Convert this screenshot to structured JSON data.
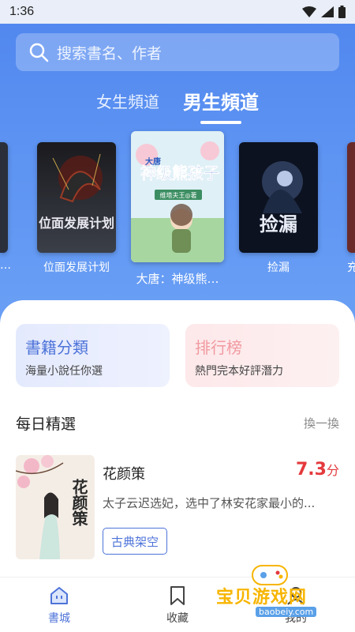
{
  "status": {
    "time": "1:36"
  },
  "search": {
    "placeholder": "搜索書名、作者"
  },
  "tabs": [
    {
      "label": "女生頻道",
      "active": false
    },
    {
      "label": "男生頻道",
      "active": true
    }
  ],
  "carousel": {
    "items": [
      {
        "title": "…"
      },
      {
        "title": "位面发展计划",
        "cover_text": "位面发展计划"
      },
      {
        "title": "大唐：神级熊…",
        "cover_text": "神级熊孩子",
        "cover_prefix": "大唐",
        "cover_author": "维塔夫王◎著"
      },
      {
        "title": "捡漏",
        "cover_text": "捡漏"
      },
      {
        "title": "充"
      }
    ]
  },
  "categories": {
    "left": {
      "title": "書籍分類",
      "subtitle": "海量小說任你選"
    },
    "right": {
      "title": "排行榜",
      "subtitle": "熱門完本好評潛力"
    }
  },
  "daily": {
    "title": "每日精選",
    "more": "換一換",
    "book": {
      "title": "花颜策",
      "score": "7.3",
      "score_unit": "分",
      "desc": "太子云迟选妃，选中了林安花家最小的...",
      "tag": "古典架空",
      "cover_text": "花颜策"
    }
  },
  "nav": [
    {
      "label": "書城",
      "active": true,
      "icon": "home-icon"
    },
    {
      "label": "收藏",
      "active": false,
      "icon": "bookmark-icon"
    },
    {
      "label": "我的",
      "active": false,
      "icon": "profile-icon"
    }
  ],
  "watermark": {
    "text": "宝贝游戏网",
    "url": "baobeiy.com"
  },
  "colors": {
    "primary": "#4d73d9",
    "score": "#e4393c",
    "header": "#5d93f2"
  }
}
